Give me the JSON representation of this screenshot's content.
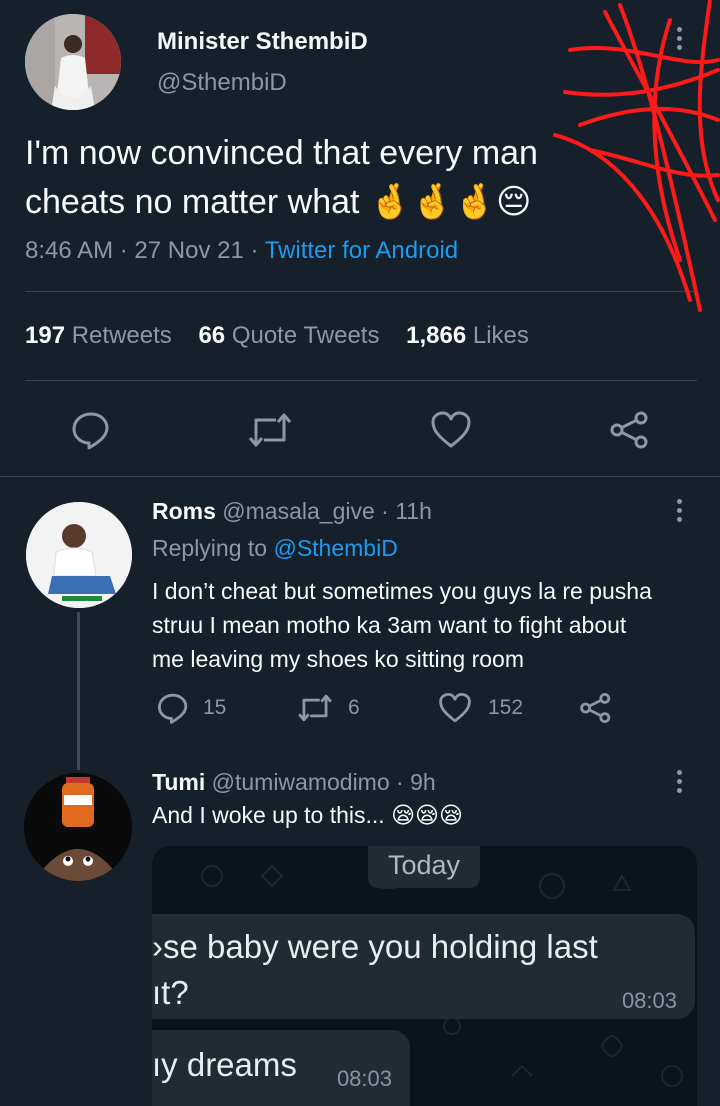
{
  "main_tweet": {
    "author_name": "Minister SthembiD",
    "author_handle": "@SthembiD",
    "text_line1": "I'm now convinced that every man",
    "text_line2": "cheats no matter what",
    "emojis": [
      "🤞",
      "🤞",
      "🤞",
      "😔"
    ],
    "time": "8:46 AM",
    "sep1": "·",
    "date": "27 Nov 21",
    "sep2": "·",
    "source": "Twitter for Android",
    "stats": {
      "retweets_count": "197",
      "retweets_label": "Retweets",
      "quotes_count": "66",
      "quotes_label": "Quote Tweets",
      "likes_count": "1,866",
      "likes_label": "Likes"
    }
  },
  "replies": [
    {
      "author_name": "Roms",
      "author_handle": "@masala_give",
      "time": "· 11h",
      "replying_prefix": "Replying to",
      "replying_to": "@SthembiD",
      "line1": "I don’t cheat but sometimes you guys la re pusha",
      "line2": "struu I mean motho ka 3am want to fight about",
      "line3": "me leaving my shoes ko sitting room",
      "reply_count": "15",
      "retweet_count": "6",
      "like_count": "152"
    },
    {
      "author_name": "Tumi",
      "author_handle": "@tumiwamodimo",
      "time": "· 9h",
      "text": "And I woke up to this...",
      "emojis": "😪😪😪"
    }
  ],
  "chat_image": {
    "date_chip": "Today",
    "msg1_line1": "›se baby were you holding last",
    "msg1_line2": "ıt?",
    "msg1_time": "08:03",
    "msg2_text": "ıy dreams",
    "msg2_time": "08:03"
  },
  "colors": {
    "background": "#15202b",
    "accent": "#1d9bf0",
    "muted": "#8b98a5",
    "divider": "#38444d",
    "scribble": "#ff1a1a"
  }
}
